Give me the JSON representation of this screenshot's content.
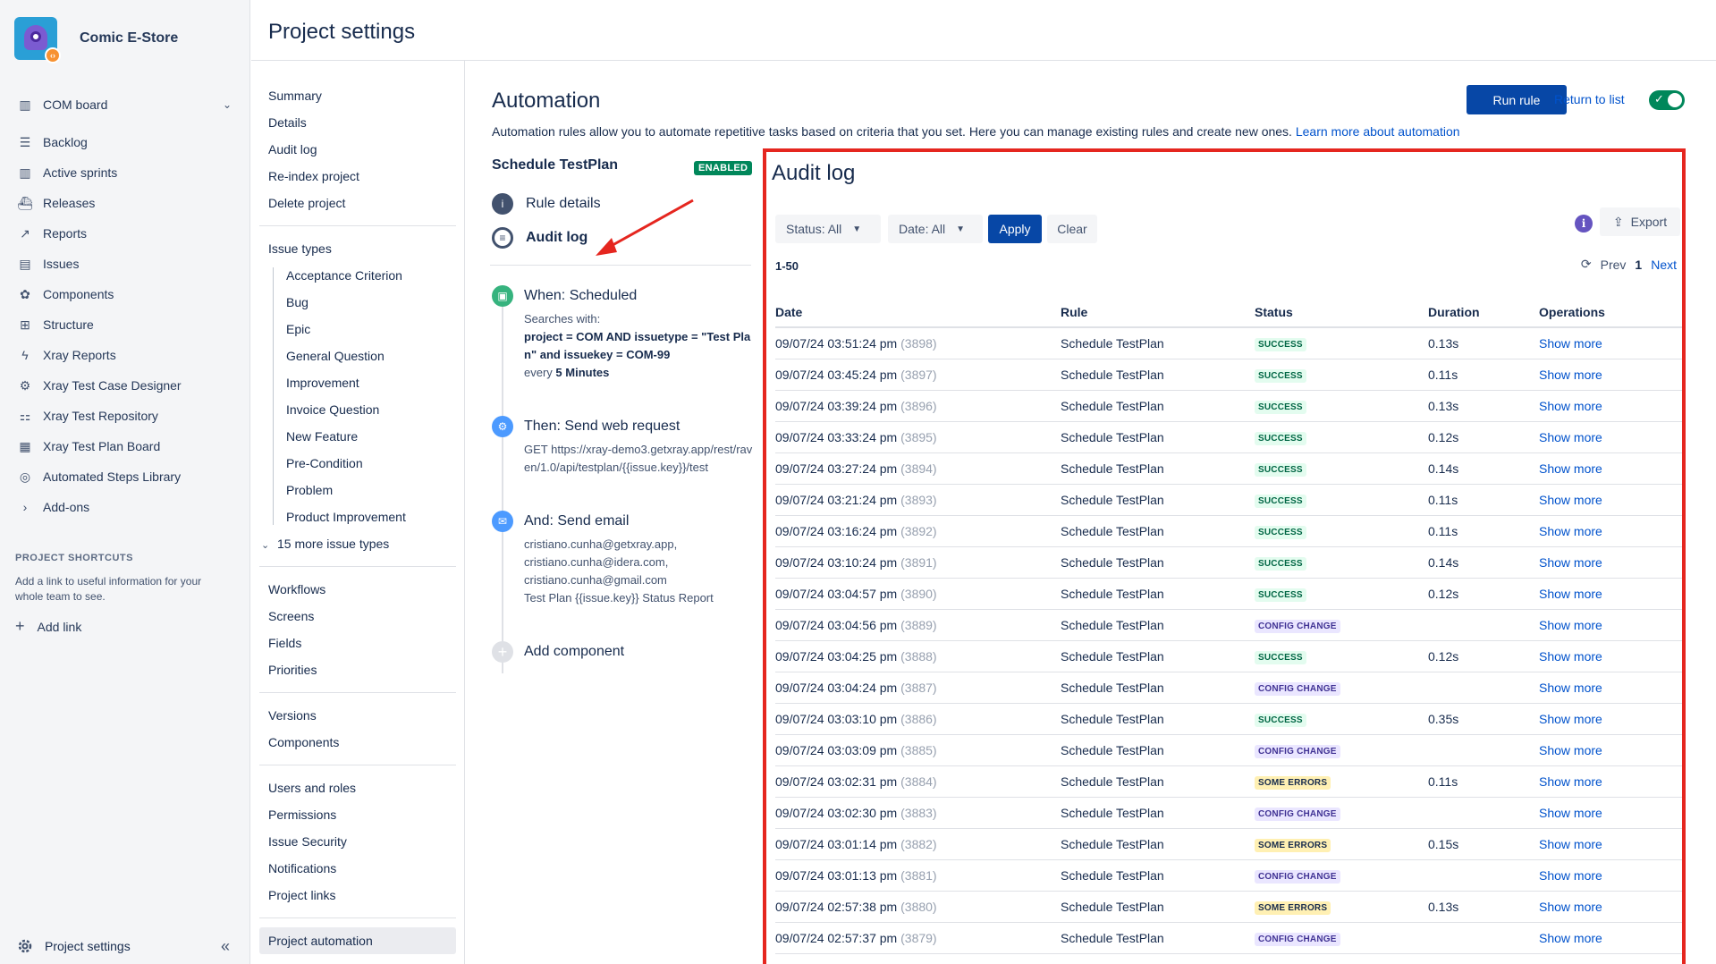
{
  "sidebar": {
    "project_name": "Comic E-Store",
    "items": [
      {
        "label": "COM board",
        "icon": "board-icon",
        "has_chevron": true
      },
      {
        "label": "Backlog",
        "icon": "backlog-icon"
      },
      {
        "label": "Active sprints",
        "icon": "sprints-icon"
      },
      {
        "label": "Releases",
        "icon": "ship-icon"
      },
      {
        "label": "Reports",
        "icon": "reports-icon"
      },
      {
        "label": "Issues",
        "icon": "issues-icon"
      },
      {
        "label": "Components",
        "icon": "components-icon"
      },
      {
        "label": "Structure",
        "icon": "structure-icon"
      },
      {
        "label": "Xray Reports",
        "icon": "bolt-icon"
      },
      {
        "label": "Xray Test Case Designer",
        "icon": "designer-icon"
      },
      {
        "label": "Xray Test Repository",
        "icon": "repository-icon"
      },
      {
        "label": "Xray Test Plan Board",
        "icon": "plan-board-icon"
      },
      {
        "label": "Automated Steps Library",
        "icon": "library-icon"
      },
      {
        "label": "Add-ons",
        "icon": "chevron-right-icon"
      }
    ],
    "shortcuts_title": "PROJECT SHORTCUTS",
    "shortcuts_desc": "Add a link to useful information for your whole team to see.",
    "add_link": "Add link",
    "footer": "Project settings"
  },
  "page_title": "Project settings",
  "settings_nav": {
    "group1": [
      "Summary",
      "Details",
      "Audit log",
      "Re-index project",
      "Delete project"
    ],
    "issue_types_label": "Issue types",
    "issue_types": [
      "Acceptance Criterion",
      "Bug",
      "Epic",
      "General Question",
      "Improvement",
      "Invoice Question",
      "New Feature",
      "Pre-Condition",
      "Problem",
      "Product Improvement"
    ],
    "more_issue_types": "15 more issue types",
    "group3": [
      "Workflows",
      "Screens",
      "Fields",
      "Priorities"
    ],
    "group4": [
      "Versions",
      "Components"
    ],
    "group5": [
      "Users and roles",
      "Permissions",
      "Issue Security",
      "Notifications",
      "Project links"
    ],
    "active": "Project automation"
  },
  "automation": {
    "title": "Automation",
    "description": "Automation rules allow you to automate repetitive tasks based on criteria that you set. Here you can manage existing rules and create new ones.",
    "learn_more": "Learn more about automation",
    "run_rule": "Run rule",
    "return_to_list": "Return to list",
    "rule_enabled": true
  },
  "rule": {
    "name": "Schedule TestPlan",
    "badge": "ENABLED",
    "details_label": "Rule details",
    "audit_label": "Audit log",
    "when_title": "When: Scheduled",
    "when_searches": "Searches with:",
    "when_query": "project = COM AND issuetype = \"Test Plan\" and issuekey = COM-99",
    "when_every_prefix": "every",
    "when_every_value": "5 Minutes",
    "then_title": "Then: Send web request",
    "then_body": "GET https://xray-demo3.getxray.app/rest/raven/1.0/api/testplan/{{issue.key}}/test",
    "and_title": "And: Send email",
    "and_recipients": [
      "cristiano.cunha@getxray.app,",
      "cristiano.cunha@idera.com,",
      "cristiano.cunha@gmail.com"
    ],
    "and_subject": "Test Plan {{issue.key}} Status Report",
    "add_component": "Add component"
  },
  "audit": {
    "title": "Audit log",
    "status_filter": "Status: All",
    "date_filter": "Date: All",
    "apply": "Apply",
    "clear": "Clear",
    "info": "i",
    "export": "Export",
    "range": "1-50",
    "prev": "Prev",
    "page": "1",
    "next": "Next",
    "columns": [
      "Date",
      "Rule",
      "Status",
      "Duration",
      "Operations"
    ],
    "rows": [
      {
        "date": "09/07/24 03:51:24 pm",
        "id": "(3898)",
        "rule": "Schedule TestPlan",
        "status": "SUCCESS",
        "duration": "0.13s",
        "op": "Show more"
      },
      {
        "date": "09/07/24 03:45:24 pm",
        "id": "(3897)",
        "rule": "Schedule TestPlan",
        "status": "SUCCESS",
        "duration": "0.11s",
        "op": "Show more"
      },
      {
        "date": "09/07/24 03:39:24 pm",
        "id": "(3896)",
        "rule": "Schedule TestPlan",
        "status": "SUCCESS",
        "duration": "0.13s",
        "op": "Show more"
      },
      {
        "date": "09/07/24 03:33:24 pm",
        "id": "(3895)",
        "rule": "Schedule TestPlan",
        "status": "SUCCESS",
        "duration": "0.12s",
        "op": "Show more"
      },
      {
        "date": "09/07/24 03:27:24 pm",
        "id": "(3894)",
        "rule": "Schedule TestPlan",
        "status": "SUCCESS",
        "duration": "0.14s",
        "op": "Show more"
      },
      {
        "date": "09/07/24 03:21:24 pm",
        "id": "(3893)",
        "rule": "Schedule TestPlan",
        "status": "SUCCESS",
        "duration": "0.11s",
        "op": "Show more"
      },
      {
        "date": "09/07/24 03:16:24 pm",
        "id": "(3892)",
        "rule": "Schedule TestPlan",
        "status": "SUCCESS",
        "duration": "0.11s",
        "op": "Show more"
      },
      {
        "date": "09/07/24 03:10:24 pm",
        "id": "(3891)",
        "rule": "Schedule TestPlan",
        "status": "SUCCESS",
        "duration": "0.14s",
        "op": "Show more"
      },
      {
        "date": "09/07/24 03:04:57 pm",
        "id": "(3890)",
        "rule": "Schedule TestPlan",
        "status": "SUCCESS",
        "duration": "0.12s",
        "op": "Show more"
      },
      {
        "date": "09/07/24 03:04:56 pm",
        "id": "(3889)",
        "rule": "Schedule TestPlan",
        "status": "CONFIG CHANGE",
        "duration": "",
        "op": "Show more"
      },
      {
        "date": "09/07/24 03:04:25 pm",
        "id": "(3888)",
        "rule": "Schedule TestPlan",
        "status": "SUCCESS",
        "duration": "0.12s",
        "op": "Show more"
      },
      {
        "date": "09/07/24 03:04:24 pm",
        "id": "(3887)",
        "rule": "Schedule TestPlan",
        "status": "CONFIG CHANGE",
        "duration": "",
        "op": "Show more"
      },
      {
        "date": "09/07/24 03:03:10 pm",
        "id": "(3886)",
        "rule": "Schedule TestPlan",
        "status": "SUCCESS",
        "duration": "0.35s",
        "op": "Show more"
      },
      {
        "date": "09/07/24 03:03:09 pm",
        "id": "(3885)",
        "rule": "Schedule TestPlan",
        "status": "CONFIG CHANGE",
        "duration": "",
        "op": "Show more"
      },
      {
        "date": "09/07/24 03:02:31 pm",
        "id": "(3884)",
        "rule": "Schedule TestPlan",
        "status": "SOME ERRORS",
        "duration": "0.11s",
        "op": "Show more"
      },
      {
        "date": "09/07/24 03:02:30 pm",
        "id": "(3883)",
        "rule": "Schedule TestPlan",
        "status": "CONFIG CHANGE",
        "duration": "",
        "op": "Show more"
      },
      {
        "date": "09/07/24 03:01:14 pm",
        "id": "(3882)",
        "rule": "Schedule TestPlan",
        "status": "SOME ERRORS",
        "duration": "0.15s",
        "op": "Show more"
      },
      {
        "date": "09/07/24 03:01:13 pm",
        "id": "(3881)",
        "rule": "Schedule TestPlan",
        "status": "CONFIG CHANGE",
        "duration": "",
        "op": "Show more"
      },
      {
        "date": "09/07/24 02:57:38 pm",
        "id": "(3880)",
        "rule": "Schedule TestPlan",
        "status": "SOME ERRORS",
        "duration": "0.13s",
        "op": "Show more"
      },
      {
        "date": "09/07/24 02:57:37 pm",
        "id": "(3879)",
        "rule": "Schedule TestPlan",
        "status": "CONFIG CHANGE",
        "duration": "",
        "op": "Show more"
      }
    ]
  },
  "colors": {
    "primary": "#0747A6",
    "link": "#0052CC",
    "success": "#00875A",
    "highlight": "#E5261F"
  }
}
